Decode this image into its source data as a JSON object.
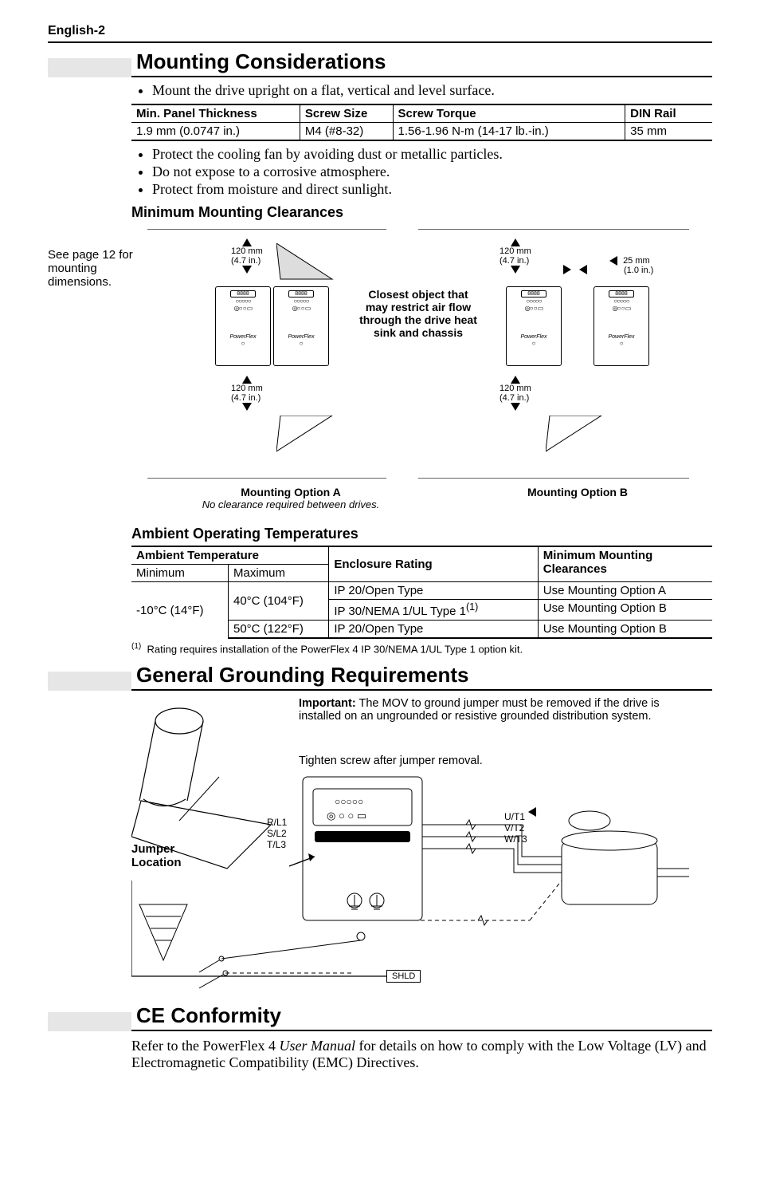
{
  "header": {
    "page_label": "English-2"
  },
  "s1": {
    "title": "Mounting Considerations",
    "b1": "Mount the drive upright on a flat, vertical and level surface.",
    "table": {
      "h1": "Min. Panel Thickness",
      "h2": "Screw Size",
      "h3": "Screw Torque",
      "h4": "DIN Rail",
      "c1": "1.9 mm (0.0747 in.)",
      "c2": "M4 (#8-32)",
      "c3": "1.56-1.96 N-m (14-17 lb.-in.)",
      "c4": "35 mm"
    },
    "b2": "Protect the cooling fan by avoiding dust or metallic particles.",
    "b3": "Do not expose to a corrosive atmosphere.",
    "b4": "Protect from moisture and direct sunlight.",
    "sub1": "Minimum Mounting Clearances",
    "fig": {
      "side_note_l1": "See page 12 for",
      "side_note_l2": "mounting dimensions.",
      "dim120": "120 mm",
      "dim120s": "(4.7 in.)",
      "dim25": "25 mm",
      "dim25s": "(1.0 in.)",
      "center1": "Closest object that",
      "center2": "may restrict air flow",
      "center3": "through the drive heat",
      "center4": "sink and chassis",
      "optA": "Mounting Option A",
      "optA_sub": "No clearance required between drives.",
      "optB": "Mounting Option B",
      "drive_label": "PowerFlex"
    },
    "sub2": "Ambient Operating Temperatures",
    "t2": {
      "h_at": "Ambient Temperature",
      "h_er": "Enclosure Rating",
      "h_mm": "Minimum Mounting",
      "h_cl": "Clearances",
      "h_min": "Minimum",
      "h_max": "Maximum",
      "r_min": "-10°C (14°F)",
      "r1_max": "40°C (104°F)",
      "r1_er": "IP 20/Open Type",
      "r1_mm": "Use Mounting Option A",
      "r2_er_a": "IP 30/NEMA 1/UL Type 1",
      "r2_er_sup": "(1)",
      "r2_mm": "Use Mounting Option B",
      "r3_max": "50°C (122°F)",
      "r3_er": "IP 20/Open Type",
      "r3_mm": "Use Mounting Option B"
    },
    "foot_sup": "(1)",
    "foot": "Rating requires installation of the PowerFlex 4 IP 30/NEMA 1/UL Type 1 option kit."
  },
  "s2": {
    "title": "General Grounding Requirements",
    "lead": "Important:",
    "l1": "The MOV to ground jumper must be removed if the drive is installed on an ungrounded or resistive grounded distribution system.",
    "l2": "Tighten screw after jumper removal.",
    "jumper_l1": "Jumper",
    "jumper_l2": "Location",
    "rl1": "R/L1",
    "sl2": "S/L2",
    "tl3": "T/L3",
    "ut1": "U/T1",
    "vt2": "V/T2",
    "wt3": "W/T3",
    "shld": "SHLD"
  },
  "s3": {
    "title": "CE Conformity",
    "body_a": "Refer to the PowerFlex 4 ",
    "body_i": "User Manual",
    "body_b": " for details on how to comply with the Low Voltage (LV) and Electromagnetic Compatibility (EMC) Directives."
  }
}
